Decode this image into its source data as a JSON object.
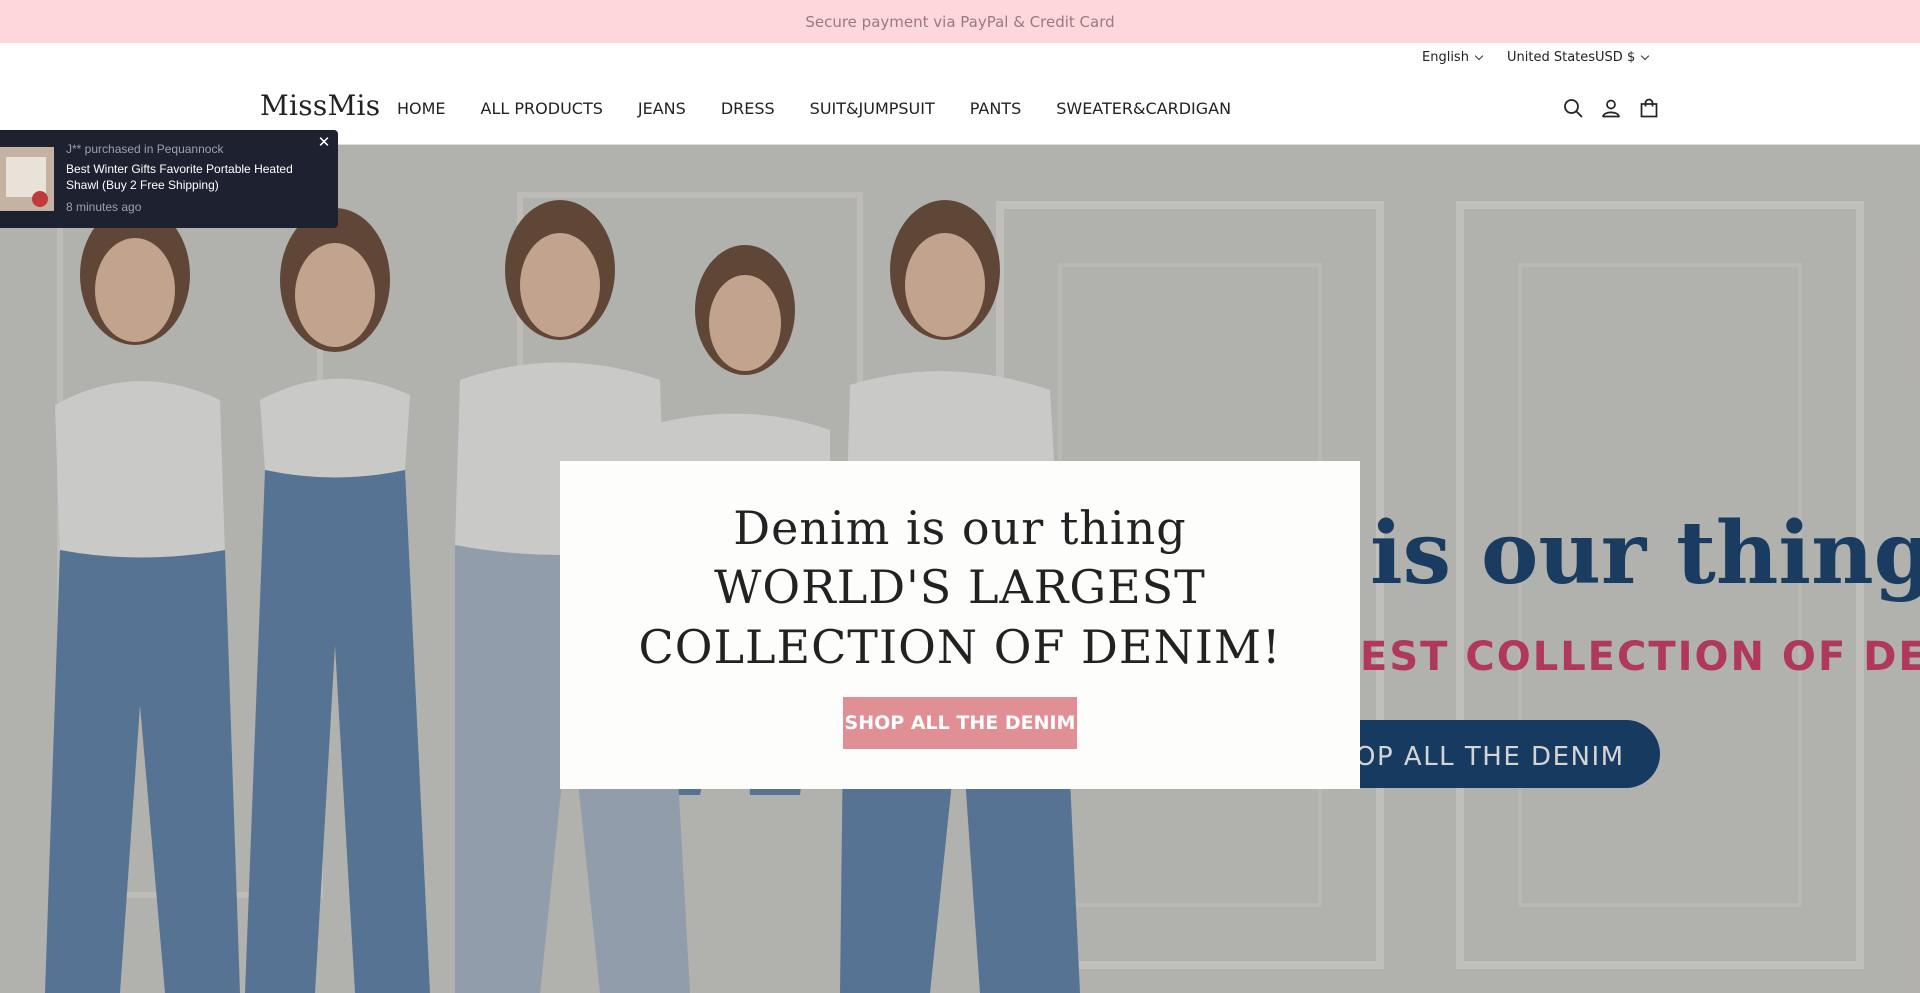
{
  "announcement": {
    "text": "Secure payment via PayPal & Credit Card",
    "bg_color": "#fdd7db"
  },
  "utility": {
    "language": "English",
    "region": "United States​USD $​"
  },
  "header": {
    "logo": "MissMis",
    "nav": [
      "HOME",
      "ALL PRODUCTS",
      "JEANS",
      "DRESS",
      "SUIT&JUMPSUIT",
      "PANTS",
      "SWEATER&CARDIGAN"
    ],
    "icons": [
      "search-icon",
      "account-icon",
      "cart-icon"
    ]
  },
  "hero": {
    "line1": "Denim is our thing",
    "line2": "WORLD'S LARGEST",
    "line3": "COLLECTION OF DENIM!",
    "button": "SHOP ALL THE DENIM",
    "button_color": "#e09095",
    "bg_text_1": "is our thing",
    "bg_text_2": "EST COLLECTION OF DENIM!",
    "bg_text_3": "OP ALL THE DENIM"
  },
  "purchase_popup": {
    "who": "J** purchased in Pequannock",
    "product": "​Best Winter Gifts ​Favorite Portable Heated Shawl (Buy 2 Free Shipping)",
    "time": "8 minutes ago"
  }
}
